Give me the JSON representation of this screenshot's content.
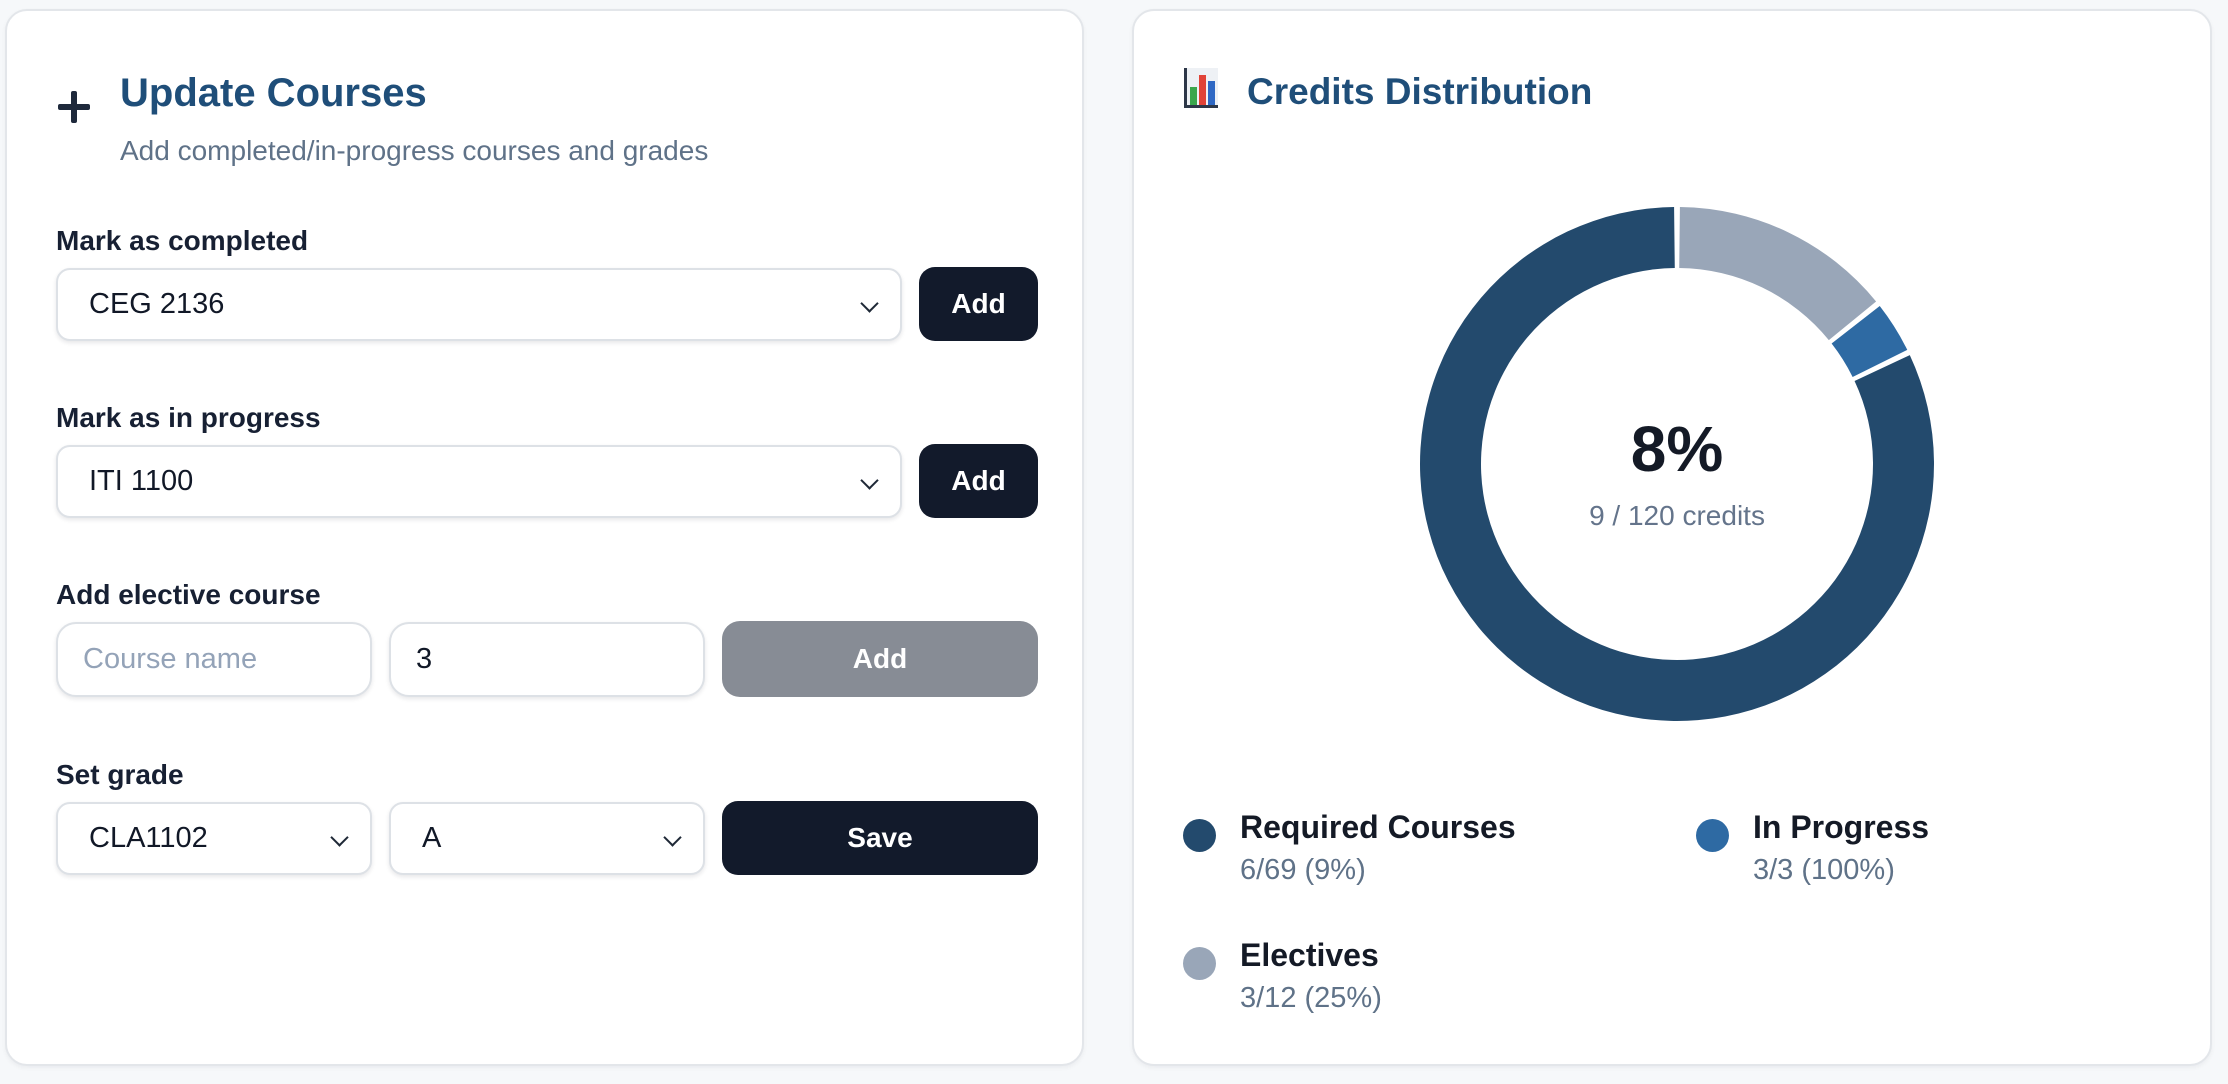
{
  "update_courses": {
    "title": "Update Courses",
    "subtitle": "Add completed/in-progress courses and grades",
    "completed": {
      "label": "Mark as completed",
      "selected": "CEG 2136",
      "button": "Add"
    },
    "in_progress": {
      "label": "Mark as in progress",
      "selected": "ITI 1100",
      "button": "Add"
    },
    "elective": {
      "label": "Add elective course",
      "name_placeholder": "Course name",
      "credits_value": "3",
      "button": "Add"
    },
    "grade": {
      "label": "Set grade",
      "course_selected": "CLA1102",
      "grade_selected": "A",
      "button": "Save"
    }
  },
  "credits_distribution": {
    "title": "Credits Distribution",
    "center_percent": "8%",
    "center_label": "9 / 120 credits",
    "legend": [
      {
        "name": "Required Courses",
        "value": "6/69 (9%)",
        "color": "#234a6d"
      },
      {
        "name": "In Progress",
        "value": "3/3 (100%)",
        "color": "#2e6aa3"
      },
      {
        "name": "Electives",
        "value": "3/12 (25%)",
        "color": "#99a6b8"
      }
    ]
  },
  "chart_data": {
    "type": "pie",
    "variant": "doughnut",
    "labels": [
      "Required Courses",
      "In Progress",
      "Electives"
    ],
    "values": [
      69,
      3,
      12
    ],
    "colors": [
      "#234a6d",
      "#2e6aa3",
      "#99a6b8"
    ]
  }
}
